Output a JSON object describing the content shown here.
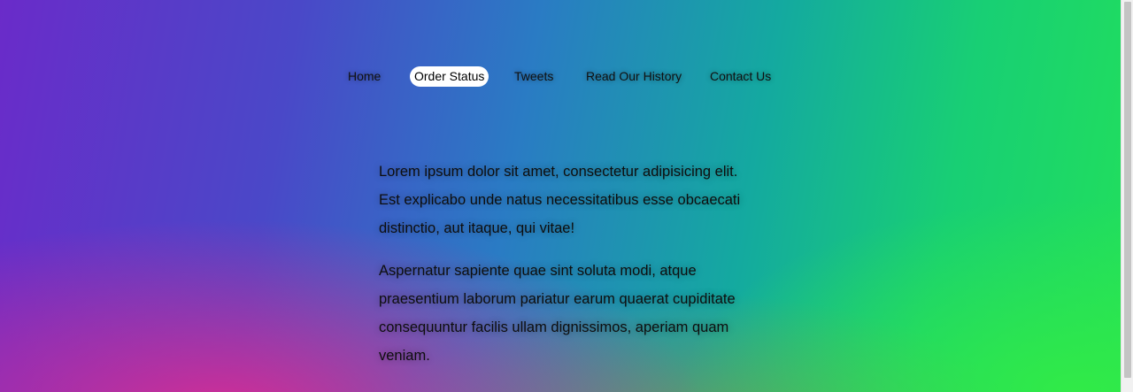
{
  "nav": {
    "items": [
      {
        "label": "Home",
        "active": false
      },
      {
        "label": "Order Status",
        "active": true
      },
      {
        "label": "Tweets",
        "active": false
      },
      {
        "label": "Read Our History",
        "active": false
      },
      {
        "label": "Contact Us",
        "active": false
      }
    ]
  },
  "content": {
    "paragraphs": [
      "Lorem ipsum dolor sit amet, consectetur adipisicing elit. Est explicabo unde natus necessitatibus esse obcaecati distinctio, aut itaque, qui vitae!",
      "Aspernatur sapiente quae sint soluta modi, atque praesentium laborum pariatur earum quaerat cupiditate consequuntur facilis ullam dignissimos, aperiam quam veniam."
    ]
  },
  "colors": {
    "active_pill_bg": "#ffffff",
    "text": "#0e0e0e",
    "gradient_purple": "#6a2bc9",
    "gradient_blue": "#2a7bc4",
    "gradient_green": "#22e05a",
    "gradient_pink": "#eb288c"
  }
}
